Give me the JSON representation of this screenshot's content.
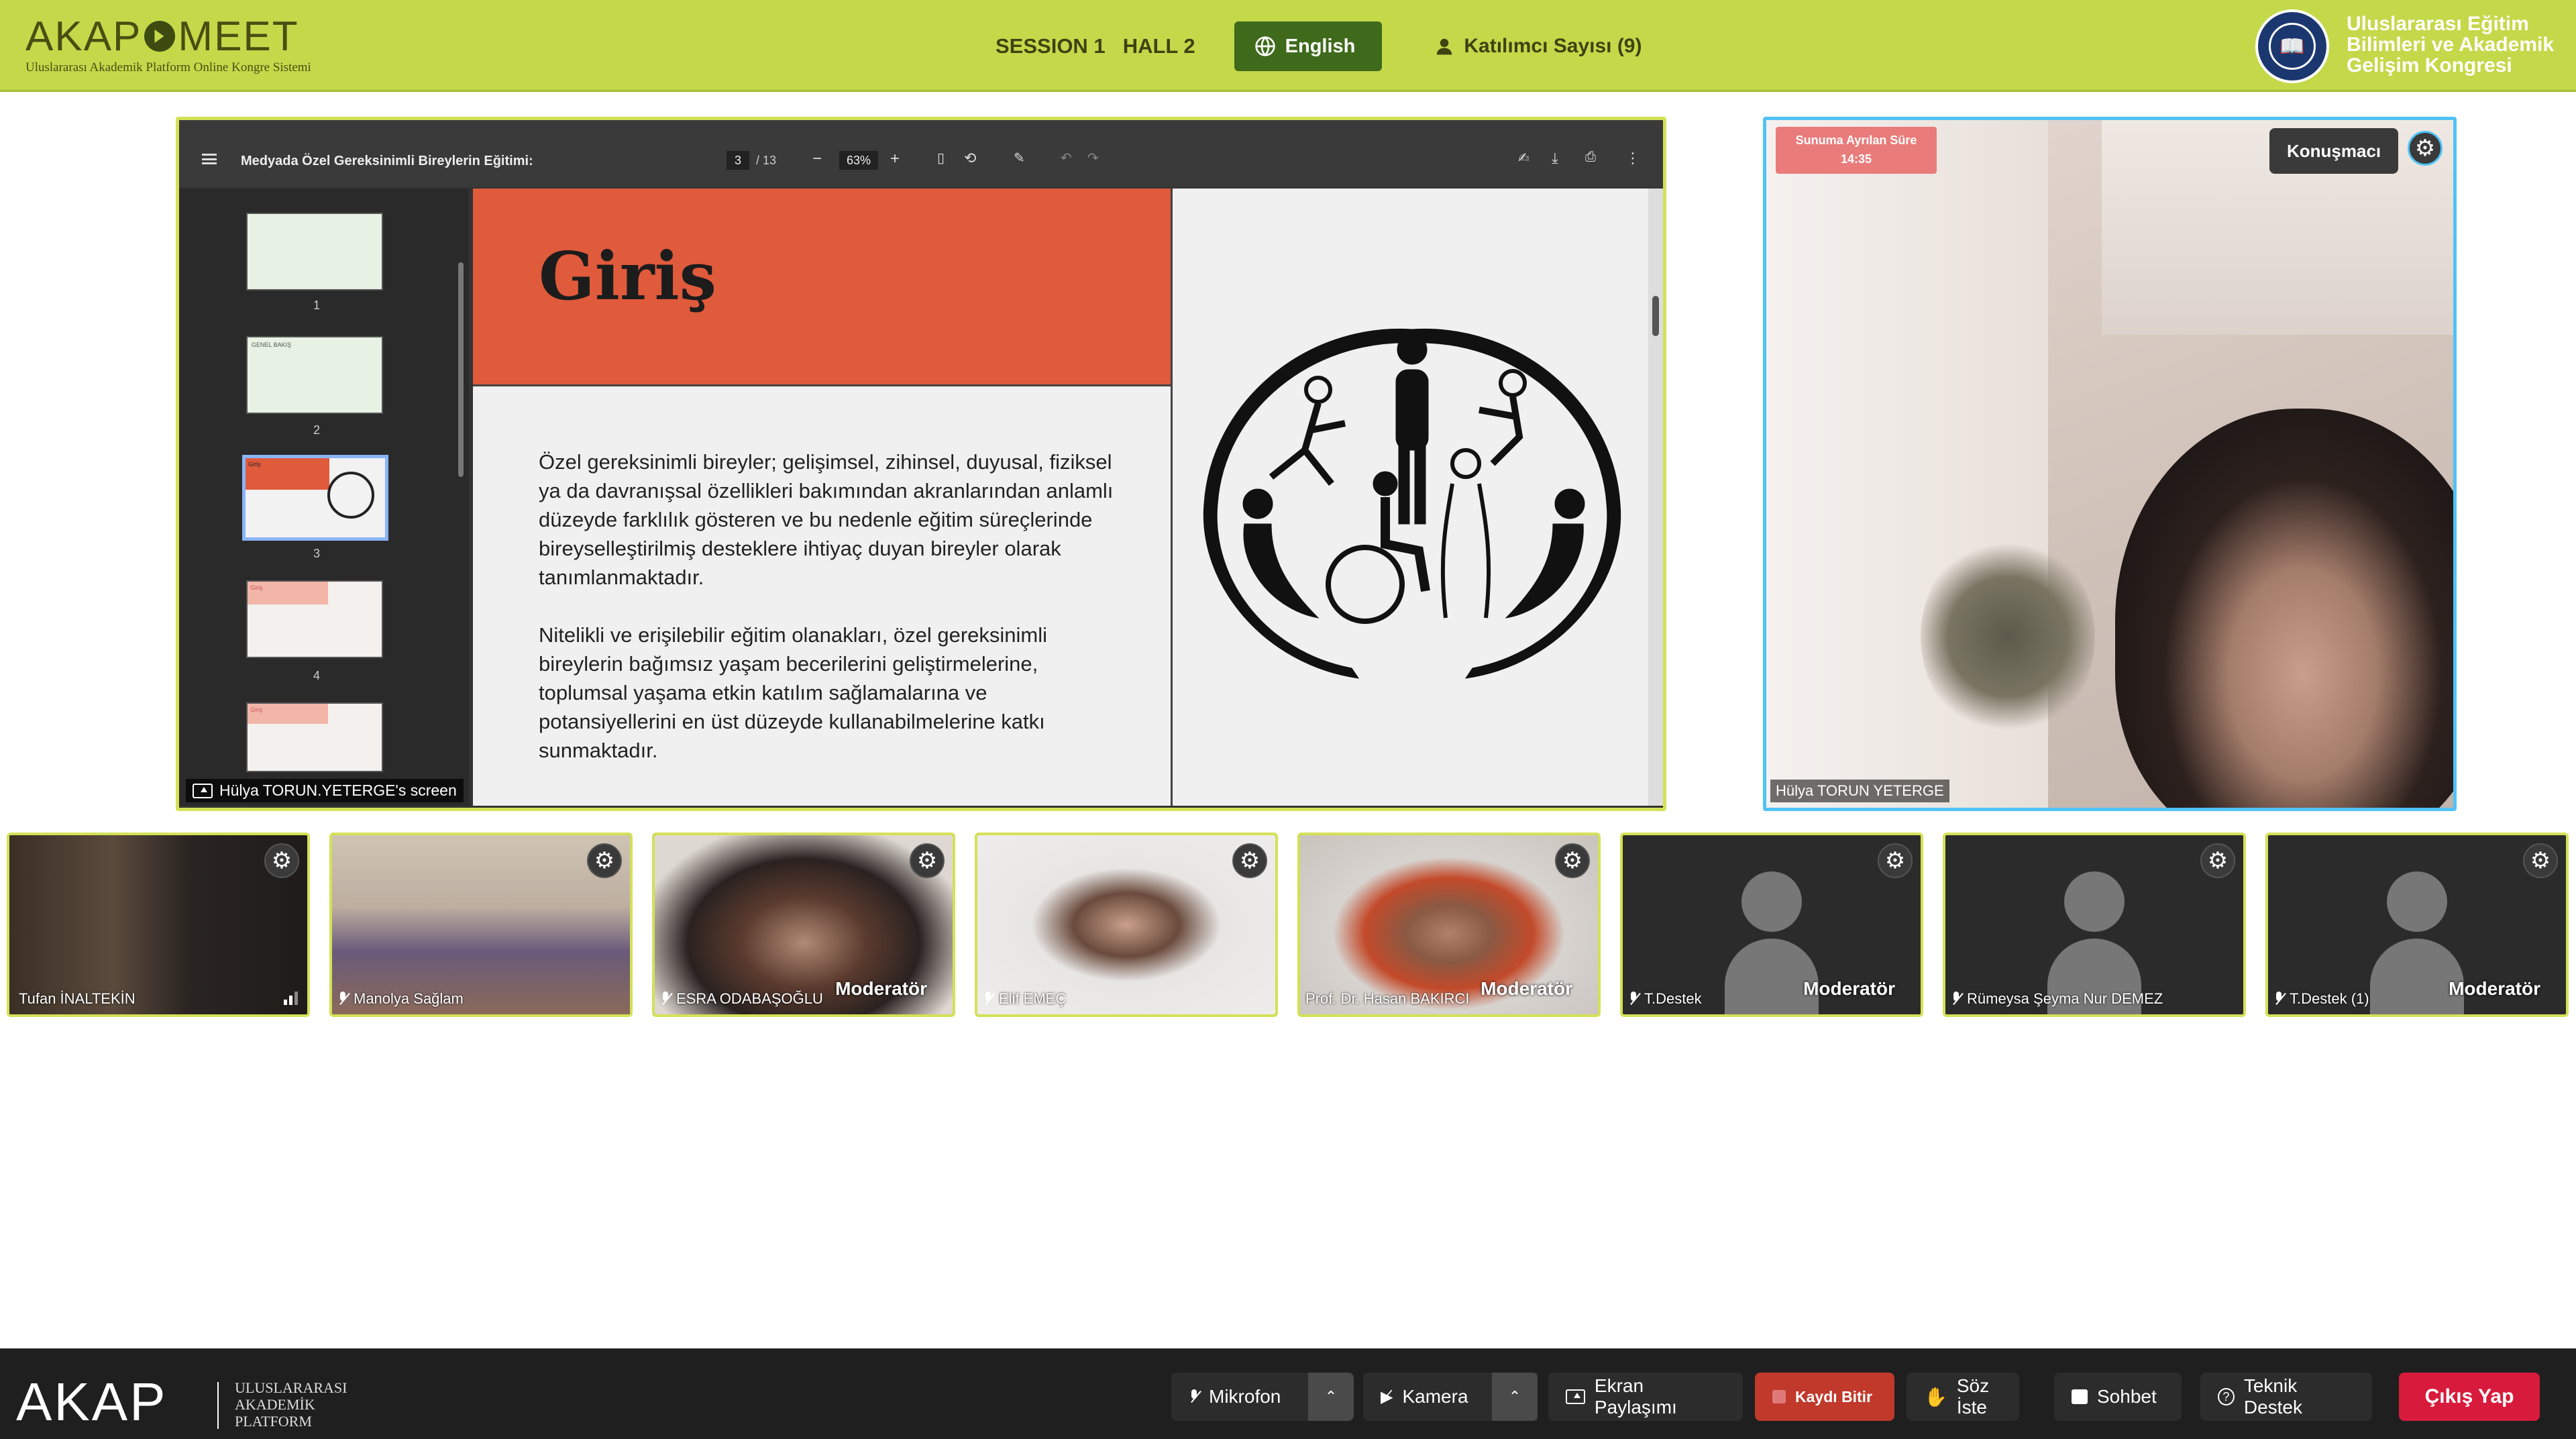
{
  "header": {
    "logo_text_left": "AKAP",
    "logo_text_right": "MEET",
    "logo_subtitle": "Uluslararası Akademik Platform Online Kongre Sistemi",
    "session": "SESSION 1",
    "hall": "HALL 2",
    "language_button": "English",
    "participants": "Katılımcı Sayısı (9)",
    "congress_name_line1": "Uluslararası Eğitim",
    "congress_name_line2": "Bilimleri ve Akademik",
    "congress_name_line3": "Gelişim Kongresi",
    "accent_color": "#c3d94a"
  },
  "pdf_viewer": {
    "title": "Medyada Özel Gereksinimli Bireylerin Eğitimi:",
    "page_current": "3",
    "page_total": "/ 13",
    "zoom": "63%",
    "thumbnail_numbers": [
      "1",
      "2",
      "3",
      "4"
    ],
    "thumb2_label": "GENEL BAKIŞ",
    "thumb3_label": "Giriş",
    "thumb4_label": "Giriş",
    "thumb5_label": "Giriş"
  },
  "slide": {
    "title": "Giriş",
    "paragraph1": "Özel gereksinimli bireyler; gelişimsel, zihinsel, duyusal, fiziksel ya da davranışsal özellikleri bakımından akranlarından anlamlı düzeyde farklılık gösteren ve bu nedenle eğitim süreçlerinde bireyselleştirilmiş desteklere ihtiyaç duyan bireyler olarak tanımlanmaktadır.",
    "paragraph2": "Nitelikli ve erişilebilir eğitim olanakları, özel gereksinimli bireylerin bağımsız yaşam becerilerini geliştirmelerine, toplumsal yaşama etkin katılım sağlamalarına ve potansiyellerini en üst düzeyde kullanabilmelerine katkı sunmaktadır."
  },
  "share_label": "Hülya TORUN.YETERGE's screen",
  "speaker": {
    "timer_label": "Sunuma Ayrılan Süre",
    "timer_value": "14:35",
    "role": "Konuşmacı",
    "name": "Hülya TORUN YETERGE"
  },
  "participants": [
    {
      "name": "Tufan İNALTEKİN",
      "moderator": "",
      "video": "camera"
    },
    {
      "name": "Manolya Sağlam",
      "moderator": "",
      "video": "camera"
    },
    {
      "name": "ESRA ODABAŞOĞLU",
      "moderator": "Moderatör",
      "video": "camera"
    },
    {
      "name": "Elif EMEÇ",
      "moderator": "",
      "video": "camera"
    },
    {
      "name": "Prof. Dr. Hasan BAKIRCI",
      "moderator": "Moderatör",
      "video": "camera"
    },
    {
      "name": "T.Destek",
      "moderator": "Moderatör",
      "video": "avatar"
    },
    {
      "name": "Rümeysa Şeyma Nur DEMEZ",
      "moderator": "",
      "video": "avatar"
    },
    {
      "name": "T.Destek (1)",
      "moderator": "Moderatör",
      "video": "avatar"
    }
  ],
  "footer": {
    "logo": "AKAP",
    "logo_text_line1": "ULUSLARARASI",
    "logo_text_line2": "AKADEMİK",
    "logo_text_line3": "PLATFORM",
    "mic": "Mikrofon",
    "camera": "Kamera",
    "screen_share": "Ekran Paylaşımı",
    "record": "Kaydı Bitir",
    "raise_hand": "Söz İste",
    "chat": "Sohbet",
    "support": "Teknik Destek",
    "exit": "Çıkış Yap",
    "exit_color": "#d81b3c"
  }
}
